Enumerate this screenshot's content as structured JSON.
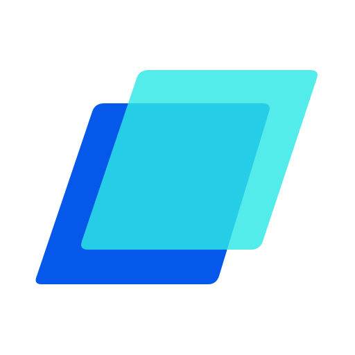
{
  "logo": {
    "icon_name": "stacked-parallelograms-logo-icon",
    "colors": {
      "background": "#ffffff",
      "back_shape": "#0558ea",
      "front_shape": "#2ee6e6",
      "front_opacity": 0.82
    }
  }
}
